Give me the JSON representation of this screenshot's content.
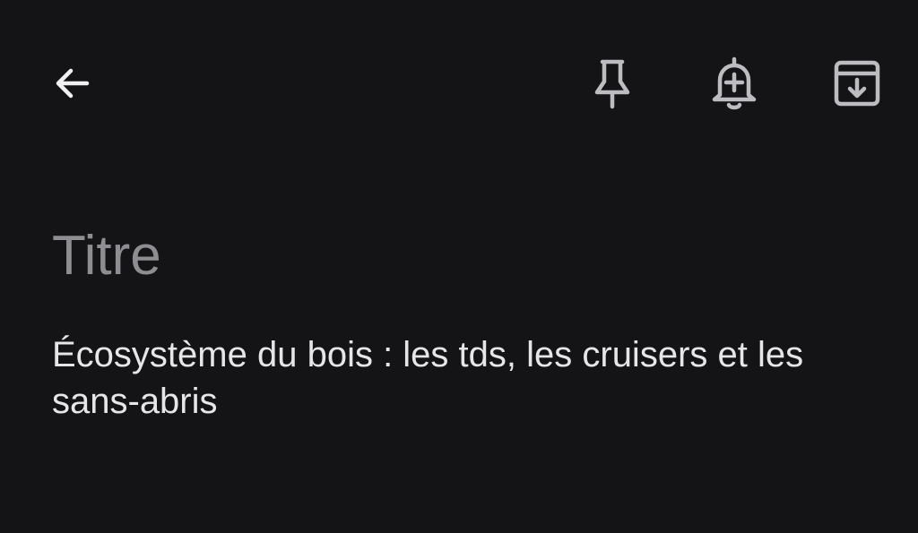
{
  "toolbar": {
    "back_icon": "arrow-left-icon",
    "pin_icon": "pin-icon",
    "reminder_icon": "bell-plus-icon",
    "archive_icon": "archive-icon",
    "icon_color": "#bdbdc1"
  },
  "note": {
    "title_placeholder": "Titre",
    "body": "Écosystème du bois : les tds, les cruisers et les sans-abris"
  },
  "colors": {
    "background": "#141417",
    "placeholder": "#8e8e92",
    "text": "#e6e6e8"
  }
}
